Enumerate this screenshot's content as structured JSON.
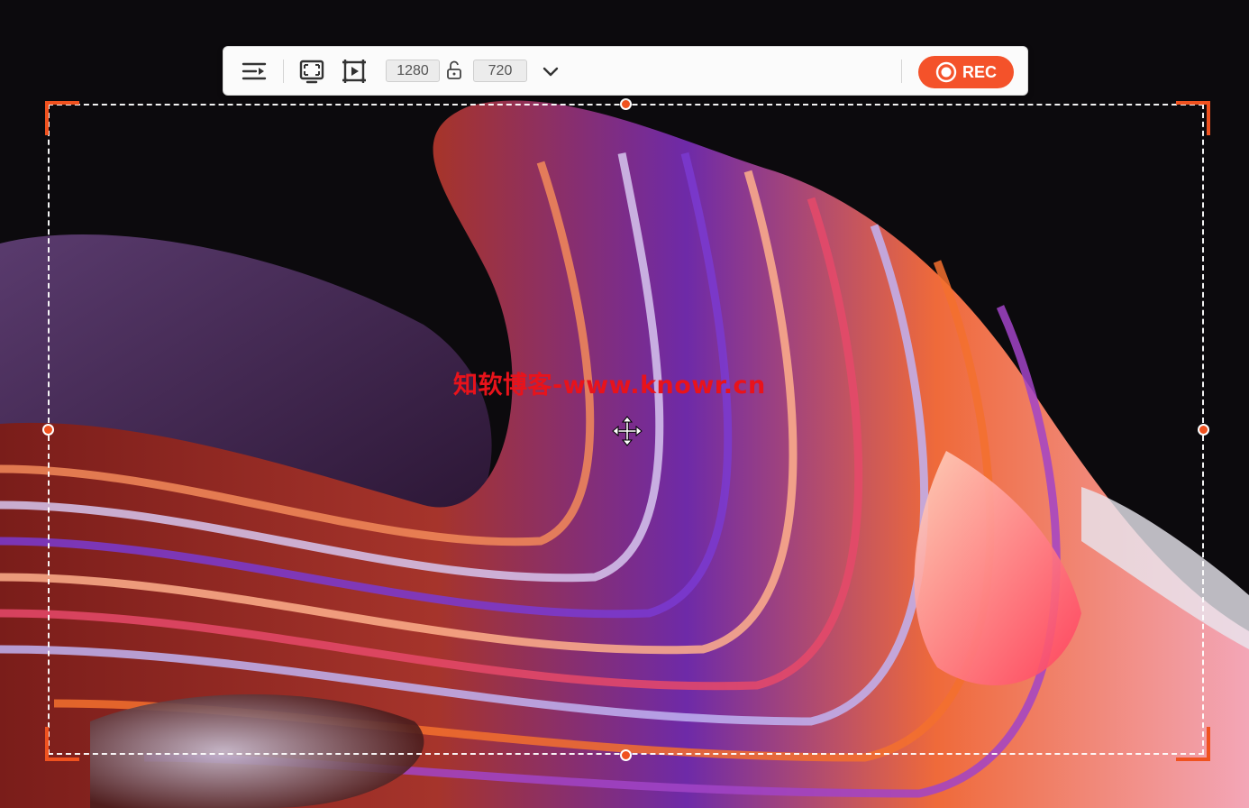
{
  "toolbar": {
    "width_value": "1280",
    "height_value": "720",
    "rec_label": "REC",
    "icons": [
      "menu-collapse-icon",
      "fullscreen-icon",
      "region-select-icon",
      "lock-aspect-icon",
      "chevron-down-icon",
      "record-icon"
    ]
  },
  "watermark": {
    "text": "知软博客-www.knowr.cn"
  },
  "colors": {
    "accent": "#f4522a",
    "region_corner": "#f0521f",
    "watermark": "#e8131b",
    "background": "#0c0a0d"
  }
}
